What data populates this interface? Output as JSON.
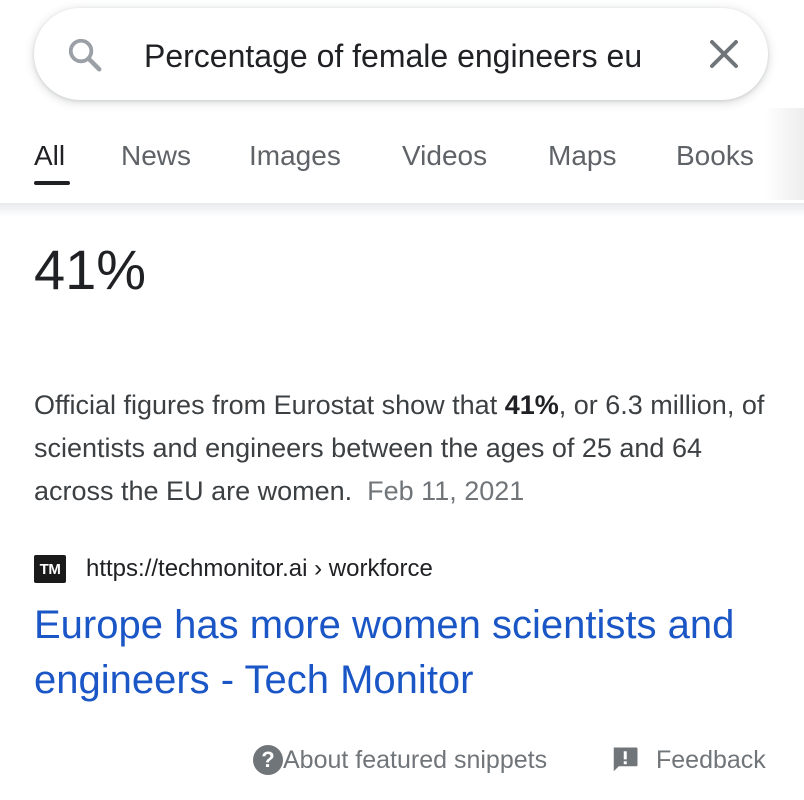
{
  "search": {
    "query": "Percentage of female engineers eu",
    "search_icon": "search-icon",
    "clear_icon": "close-icon"
  },
  "tabs": [
    {
      "label": "All",
      "active": true
    },
    {
      "label": "News",
      "active": false
    },
    {
      "label": "Images",
      "active": false
    },
    {
      "label": "Videos",
      "active": false
    },
    {
      "label": "Maps",
      "active": false
    },
    {
      "label": "Books",
      "active": false
    }
  ],
  "snippet": {
    "answer": "41%",
    "text_before": "Official figures from Eurostat show that ",
    "text_bold": "41%",
    "text_after": ", or 6.3 million, of scientists and engineers between the ages of 25 and 64 across the EU are women.",
    "date": "Feb 11, 2021",
    "favicon_text": "TM",
    "source_url": "https://techmonitor.ai › workforce",
    "result_title": "Europe has more women scientists and engineers - Tech Monitor"
  },
  "footer": {
    "about_label": "About featured snippets",
    "about_icon": "help-icon",
    "feedback_label": "Feedback",
    "feedback_icon": "feedback-icon"
  },
  "colors": {
    "link": "#1a56c6",
    "text": "#202124",
    "muted": "#70757a"
  }
}
